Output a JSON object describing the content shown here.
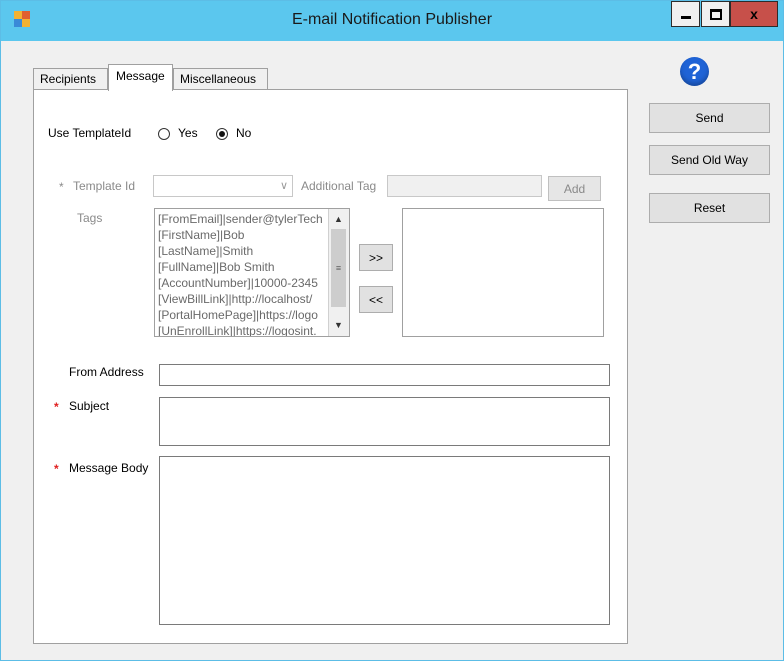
{
  "window": {
    "title": "E-mail Notification Publisher"
  },
  "tabs": [
    {
      "label": "Recipients"
    },
    {
      "label": "Message"
    },
    {
      "label": "Miscellaneous"
    }
  ],
  "message": {
    "use_template_label": "Use TemplateId",
    "radio_yes": "Yes",
    "radio_no": "No",
    "selected": "No",
    "template_id_label": "Template Id",
    "additional_tag_label": "Additional Tag",
    "add_button": "Add",
    "tags_label": "Tags",
    "tags": [
      "[FromEmail]|sender@tylerTech",
      "[FirstName]|Bob",
      "[LastName]|Smith",
      "[FullName]|Bob Smith",
      "[AccountNumber]|10000-2345",
      "[ViewBillLink]|http://localhost/",
      "[PortalHomePage]|https://logo",
      "[UnEnrollLink]|https://logosint."
    ],
    "move_right_button": ">>",
    "move_left_button": "<<",
    "from_address_label": "From Address",
    "subject_label": "Subject",
    "message_body_label": "Message Body",
    "required_mark": "*"
  },
  "actions": {
    "send": "Send",
    "send_old_way": "Send Old Way",
    "reset": "Reset",
    "help_glyph": "?"
  }
}
